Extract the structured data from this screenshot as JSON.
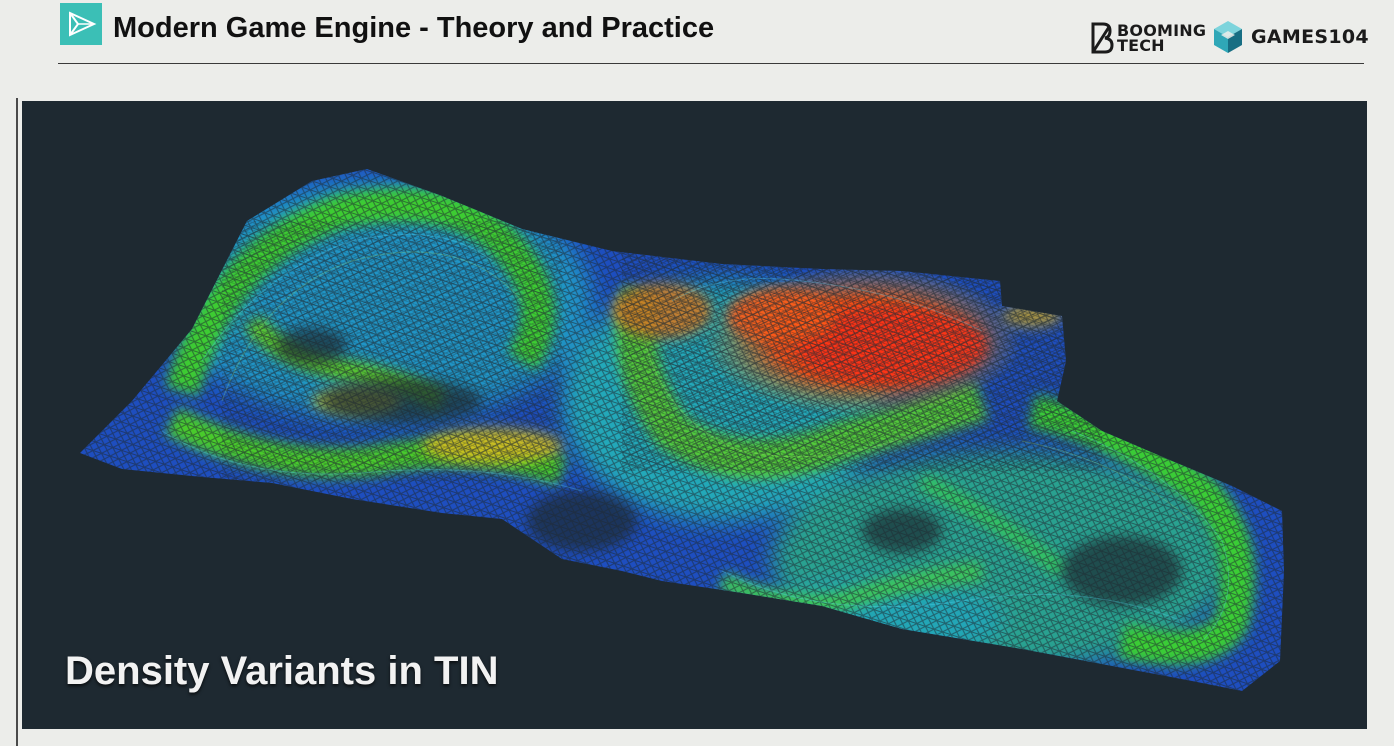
{
  "header": {
    "title": "Modern Game Engine - Theory and Practice",
    "icon": "play-triangle-icon",
    "accent_color": "#3bbfb6"
  },
  "brands": {
    "booming_line1": "BOOMING",
    "booming_line2": "TECH",
    "games": "GAMES104"
  },
  "slide": {
    "caption": "Density Variants in TIN",
    "background_color": "#1e2931",
    "figure": "tin-wireframe-terrain",
    "heat_colors": [
      "#1f55e0",
      "#1fb9d2",
      "#3cd030",
      "#d8c020",
      "#ff3a12"
    ]
  }
}
